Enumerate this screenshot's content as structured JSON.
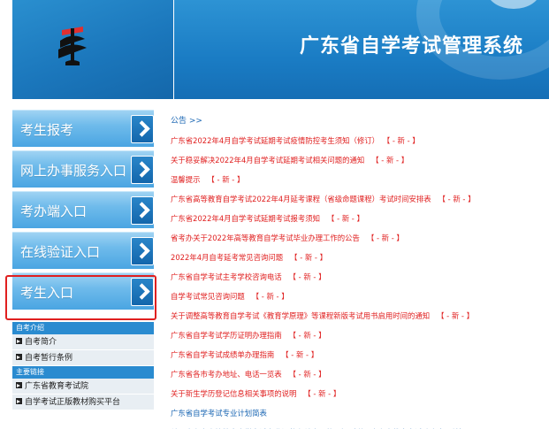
{
  "header": {
    "site_title": "广东省自学考试管理系统",
    "colors": {
      "primary": "#1b77bc",
      "menu": "#4aa5e2",
      "news_red": "#e02020",
      "link_blue": "#1a66b3"
    }
  },
  "menu": {
    "items": [
      {
        "label": "考生报考"
      },
      {
        "label": "网上办事服务入口"
      },
      {
        "label": "考办端入口"
      },
      {
        "label": "在线验证入口"
      },
      {
        "label": "考生入口"
      }
    ]
  },
  "left_sections": {
    "intro_title": "自考介绍",
    "intro_items": [
      "自考简介",
      "自考暂行条例"
    ],
    "links_title": "主要链接",
    "links_items": [
      "广东省教育考试院",
      "自学考试正版教材购买平台"
    ]
  },
  "news": {
    "heading": "公告 >>",
    "new_tag": "【 - 新 - 】",
    "items": [
      {
        "text": "广东省2022年4月自学考试延期考试疫情防控考生须知（修订）",
        "has_new": true
      },
      {
        "text": "关于稳妥解决2022年4月自学考试延期考试相关问题的通知",
        "has_new": true
      },
      {
        "text": "温馨提示",
        "has_new": true
      },
      {
        "text": "广东省高等教育自学考试2022年4月延考课程（省级命题课程）考试时间安排表",
        "has_new": true
      },
      {
        "text": "广东省2022年4月自学考试延期考试报考须知",
        "has_new": true
      },
      {
        "text": "省考办关于2022年高等教育自学考试毕业办理工作的公告",
        "has_new": true
      },
      {
        "text": "2022年4月自考延考常见咨询问题",
        "has_new": true
      },
      {
        "text": "广东省自学考试主考学校咨询电话",
        "has_new": true
      },
      {
        "text": "自学考试常见咨询问题",
        "has_new": true
      },
      {
        "text": "关于调整高等教育自学考试《教育学原理》等课程新版考试用书启用时间的通知",
        "has_new": true
      },
      {
        "text": "广东省自学考试学历证明办理指南",
        "has_new": true
      },
      {
        "text": "广东省自学考试成绩单办理指南",
        "has_new": true
      },
      {
        "text": "广东省各市考办地址、电话一览表",
        "has_new": true
      },
      {
        "text": "关于新生学历登记信息相关事项的说明",
        "has_new": true
      },
      {
        "text": "广东省自学考试专业计划简表",
        "has_new": false
      },
      {
        "text": "关于广东省高等教育自学考试专业调整有关事项的通知（详见广东省教育考试院官方网站）",
        "has_new": false
      }
    ]
  }
}
